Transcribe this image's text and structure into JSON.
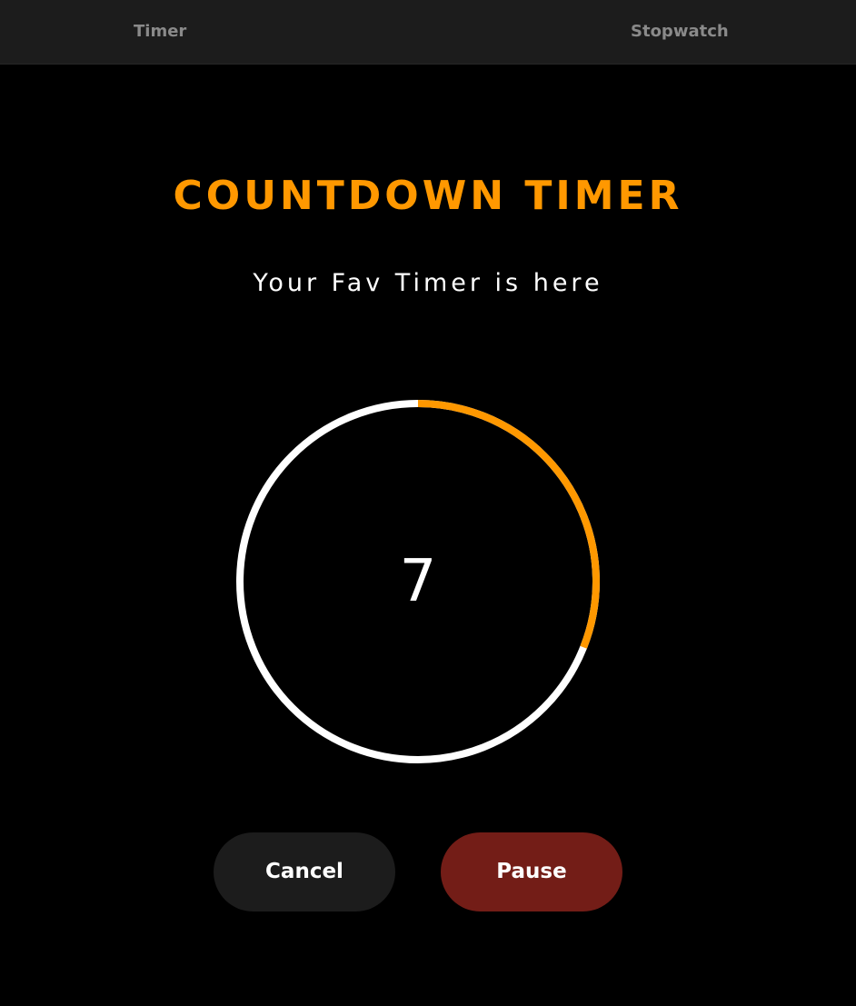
{
  "nav": {
    "tabs": [
      {
        "label": "Timer"
      },
      {
        "label": "Stopwatch"
      }
    ]
  },
  "title": "COUNTDOWN TIMER",
  "subtitle": "Your Fav Timer is here",
  "timer": {
    "remaining": "7",
    "progress_fraction": 0.31,
    "progress_color": "#ff9800",
    "track_color": "#ffffff"
  },
  "actions": {
    "cancel_label": "Cancel",
    "pause_label": "Pause"
  },
  "colors": {
    "accent": "#ff9800",
    "pause_button": "#731d17",
    "cancel_button": "#1c1c1c",
    "nav_background": "#1c1c1c",
    "background": "#000000"
  }
}
